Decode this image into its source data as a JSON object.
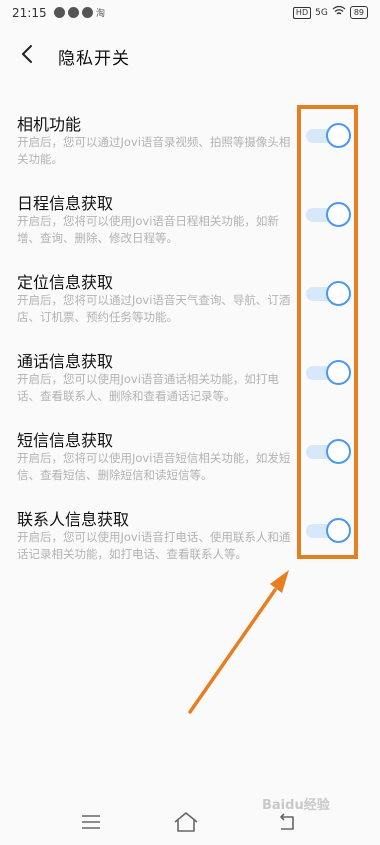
{
  "status_bar": {
    "time": "21:15",
    "app_tag": "淘",
    "hd_label": "HD",
    "network_label": "5G",
    "battery": "89"
  },
  "header": {
    "title": "隐私开关",
    "back_icon": "chevron-left-icon"
  },
  "settings": [
    {
      "title": "相机功能",
      "desc": "开启后，您可以通过Jovi语音录视频、拍照等摄像头相关功能。",
      "enabled": true
    },
    {
      "title": "日程信息获取",
      "desc": "开启后，您将可以使用Jovi语音日程相关功能，如新增、查询、删除、修改日程等。",
      "enabled": true
    },
    {
      "title": "定位信息获取",
      "desc": "开启后，您将可以通过Jovi语音天气查询、导航、订酒店、订机票、预约任务等功能。",
      "enabled": true
    },
    {
      "title": "通话信息获取",
      "desc": "开启后，您可以使用Jovi语音通话相关功能，如打电话、查看联系人、删除和查看通话记录等。",
      "enabled": true
    },
    {
      "title": "短信信息获取",
      "desc": "开启后，您将可以使用Jovi语音短信相关功能，如发短信、查看短信、删除短信和读短信等。",
      "enabled": true
    },
    {
      "title": "联系人信息获取",
      "desc": "开启后，您可以使用Jovi语音打电话、使用联系人和通话记录相关功能，如打电话、查看联系人等。",
      "enabled": true
    }
  ],
  "nav_bar": {
    "menu_icon": "menu-icon",
    "home_icon": "home-icon",
    "back_icon": "back-icon"
  },
  "colors": {
    "accent": "#4b98f2",
    "track": "#d7e8fb",
    "annotation": "#e67e22"
  }
}
